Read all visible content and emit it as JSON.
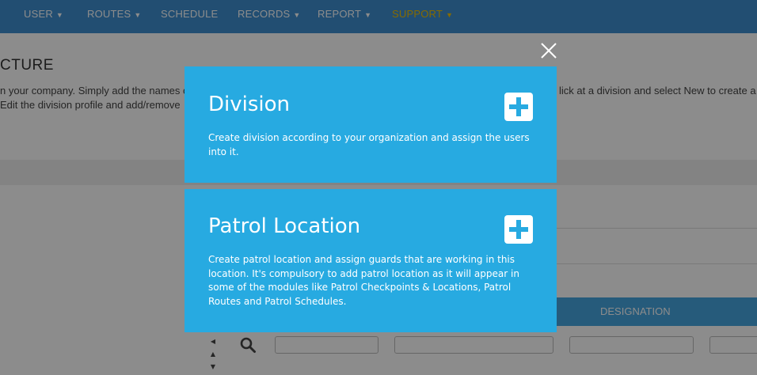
{
  "nav": {
    "items": [
      {
        "label": "USER",
        "caret": "▼"
      },
      {
        "label": "ROUTES",
        "caret": "▼"
      },
      {
        "label": "SCHEDULE",
        "caret": ""
      },
      {
        "label": "RECORDS",
        "caret": "▼"
      },
      {
        "label": "REPORT",
        "caret": "▼"
      },
      {
        "label": "SUPPORT",
        "caret": "▼"
      }
    ]
  },
  "page": {
    "title_fragment": "CTURE",
    "intro_line1_left": "n your company. Simply add the names o",
    "intro_line1_right": "lick at a division and select New to create a",
    "intro_line2_left": "Edit the division profile and add/remove"
  },
  "table": {
    "header_designation": "DESIGNATION"
  },
  "colors": {
    "nav_bg": "#3e8fd0",
    "card_bg": "#27aae1",
    "support_accent": "#f2c200"
  },
  "modal": {
    "division": {
      "title": "Division",
      "description": "Create division according to your organization and assign the users into it."
    },
    "patrol_location": {
      "title": "Patrol Location",
      "description": "Create patrol location and assign guards that are working in this location. It's compulsory to add patrol location as it will appear in some of the modules like Patrol Checkpoints & Locations, Patrol Routes and Patrol Schedules."
    }
  }
}
